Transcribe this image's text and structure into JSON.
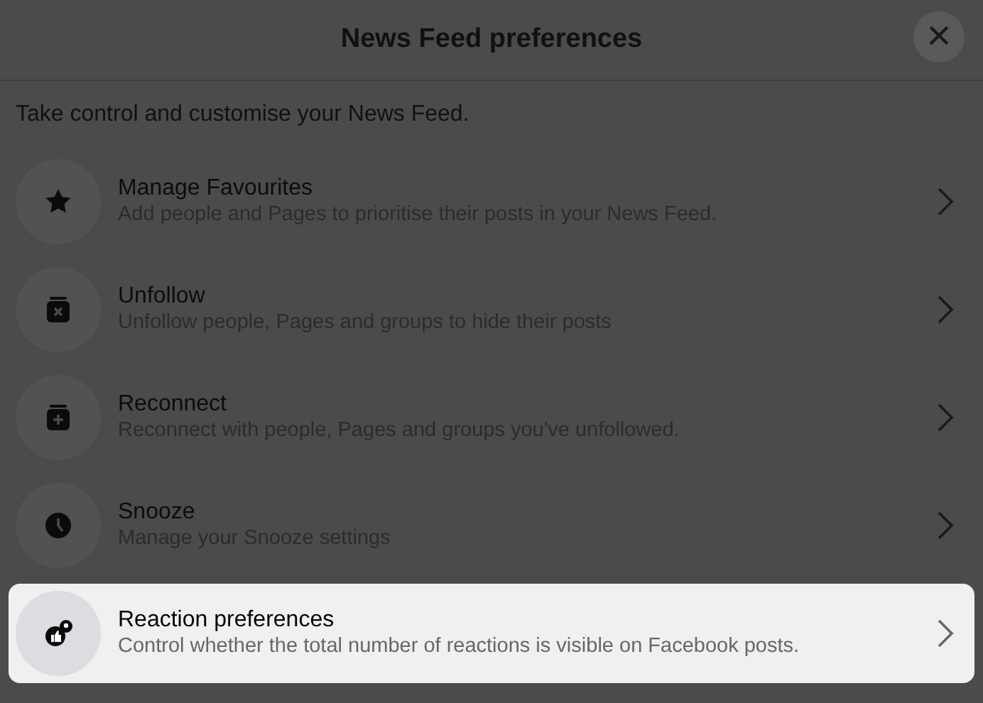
{
  "header": {
    "title": "News Feed preferences",
    "close": "×"
  },
  "intro": "Take control and customise your News Feed.",
  "items": [
    {
      "kind": "star",
      "title": "Manage Favourites",
      "subtitle": "Add people and Pages to prioritise their posts in your News Feed.",
      "highlighted": false
    },
    {
      "kind": "unfollow",
      "title": "Unfollow",
      "subtitle": "Unfollow people, Pages and groups to hide their posts",
      "highlighted": false
    },
    {
      "kind": "reconnect",
      "title": "Reconnect",
      "subtitle": "Reconnect with people, Pages and groups you've unfollowed.",
      "highlighted": false
    },
    {
      "kind": "snooze",
      "title": "Snooze",
      "subtitle": "Manage your Snooze settings",
      "highlighted": false
    },
    {
      "kind": "reaction",
      "title": "Reaction preferences",
      "subtitle": "Control whether the total number of reactions is visible on Facebook posts.",
      "highlighted": true
    }
  ]
}
